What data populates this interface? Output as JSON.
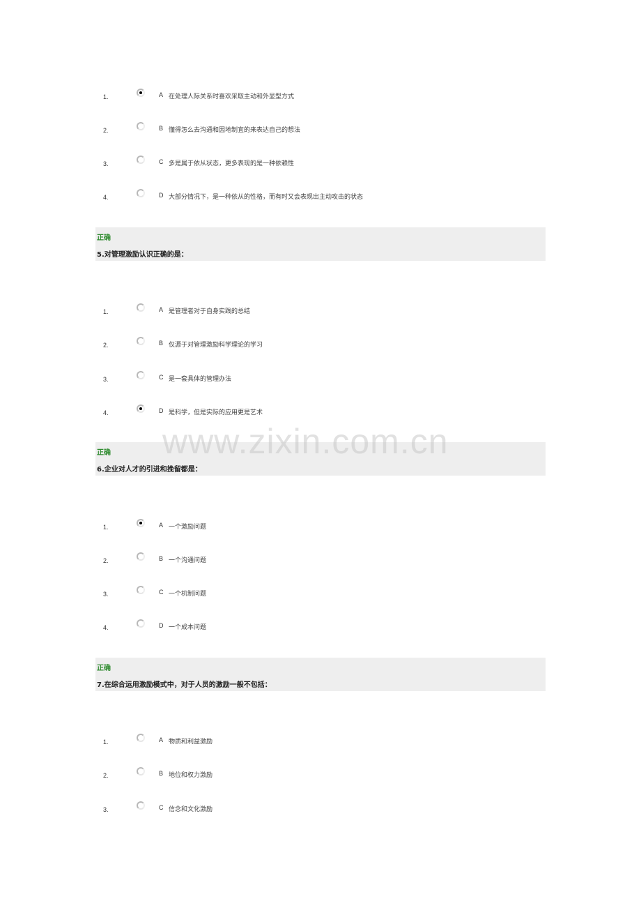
{
  "watermark": "www.zixin.com.cn",
  "question4": {
    "options": [
      {
        "num": "1.",
        "letter": "A",
        "text": "在处理人际关系时喜欢采取主动和外显型方式",
        "selected": true
      },
      {
        "num": "2.",
        "letter": "B",
        "text": "懂得怎么去沟通和因地制宜的来表达自己的想法",
        "selected": false
      },
      {
        "num": "3.",
        "letter": "C",
        "text": "多是属于依从状态，更多表现的是一种依赖性",
        "selected": false
      },
      {
        "num": "4.",
        "letter": "D",
        "text": "大部分情况下，是一种依从的性格，而有时又会表现出主动攻击的状态",
        "selected": false
      }
    ]
  },
  "question5": {
    "status": "正确",
    "title": "5.对管理激励认识正确的是：",
    "options": [
      {
        "num": "1.",
        "letter": "A",
        "text": "是管理者对于自身实践的总结",
        "selected": false
      },
      {
        "num": "2.",
        "letter": "B",
        "text": "仅源于对管理激励科学理论的学习",
        "selected": false
      },
      {
        "num": "3.",
        "letter": "C",
        "text": "是一套具体的管理办法",
        "selected": false
      },
      {
        "num": "4.",
        "letter": "D",
        "text": "是科学，但是实际的应用更是艺术",
        "selected": true
      }
    ]
  },
  "question6": {
    "status": "正确",
    "title": "6.企业对人才的引进和挽留都是：",
    "options": [
      {
        "num": "1.",
        "letter": "A",
        "text": "一个激励问题",
        "selected": true
      },
      {
        "num": "2.",
        "letter": "B",
        "text": "一个沟通问题",
        "selected": false
      },
      {
        "num": "3.",
        "letter": "C",
        "text": "一个机制问题",
        "selected": false
      },
      {
        "num": "4.",
        "letter": "D",
        "text": "一个成本问题",
        "selected": false
      }
    ]
  },
  "question7": {
    "status": "正确",
    "title": "7.在综合运用激励模式中，对于人员的激励一般不包括：",
    "options": [
      {
        "num": "1.",
        "letter": "A",
        "text": "物质和利益激励",
        "selected": false
      },
      {
        "num": "2.",
        "letter": "B",
        "text": "地位和权力激励",
        "selected": false
      },
      {
        "num": "3.",
        "letter": "C",
        "text": "信念和文化激励",
        "selected": false
      }
    ]
  }
}
